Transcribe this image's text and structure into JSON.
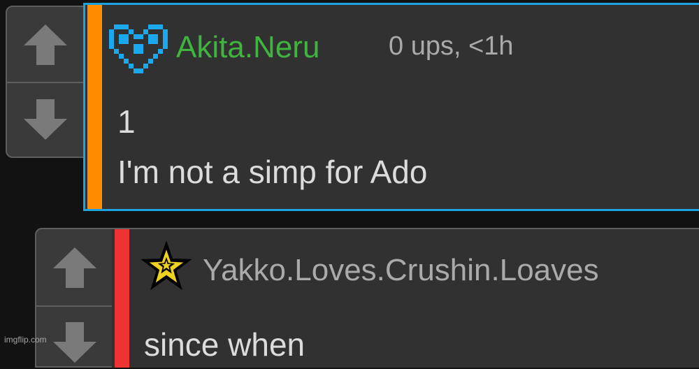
{
  "comments": [
    {
      "username": "Akita.Neru",
      "meta": "0 ups, <1h",
      "lines": [
        "1",
        "I'm not a simp for Ado"
      ],
      "stripe_color": "#ff8c00",
      "username_color": "#3fb53f",
      "highlight_color": "#1aa3e0",
      "badge_icon": "pixel-heart-icon",
      "badge_color": "#1aa9ee"
    },
    {
      "username": "Yakko.Loves.Crushin.Loaves",
      "lines": [
        "since when"
      ],
      "stripe_color": "#ee3333",
      "username_color": "#aaaaaa",
      "badge_icon": "star-icon",
      "badge_color": "#f0d020"
    }
  ],
  "watermark": "imgflip.com"
}
